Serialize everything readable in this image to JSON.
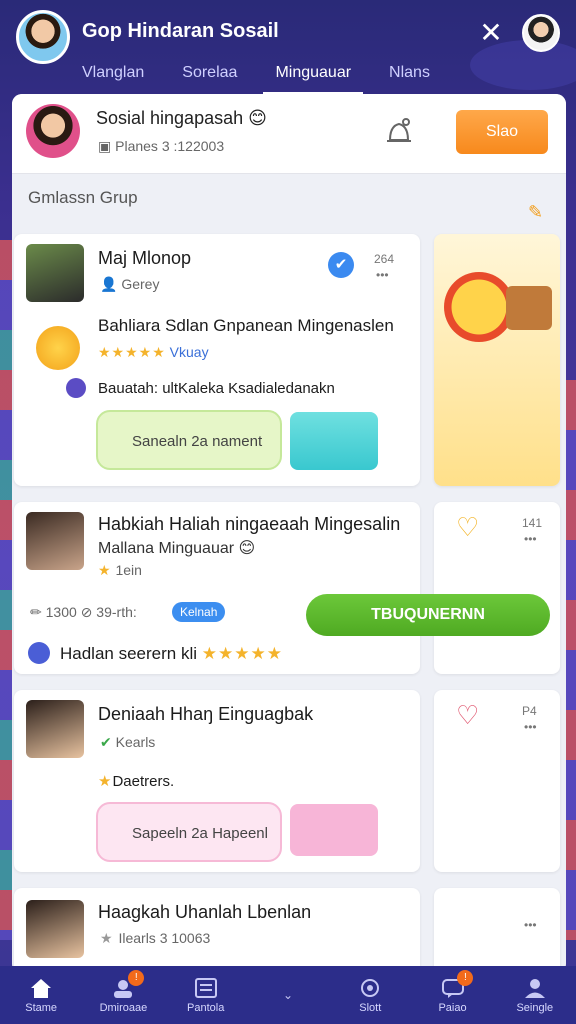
{
  "header": {
    "title": "Gop Hindaran Sosail",
    "close_symbol": "✕",
    "tabs": [
      "Vlanglan",
      "Sorelaa",
      "Minguauar",
      "Nlans"
    ],
    "active_tab": 2
  },
  "group": {
    "title": "Sosial hingapasah 😊",
    "sub": "Planes 3 :122003",
    "join_label": "Slao"
  },
  "section": {
    "label": "Gmlassn Grup"
  },
  "posts": [
    {
      "name": "Maj Mlonop",
      "sub": "Gerey",
      "count": "264",
      "text": "Bahliara Sdlan Gnpanean Mingenaslen",
      "stars": "★★★★★",
      "tag": "Vkuay",
      "line2": "Bauatah: ultKaleka Ksadialedanakn",
      "pill_label": "Sanealn 2a",
      "pill_sub": "nament"
    },
    {
      "name": "Habkiah Haliah ningaeaah Mingesalin",
      "sub": "Mallana Minguauar 😊",
      "sub2": "1ein",
      "count": "141",
      "metric_a": "1300",
      "metric_b": "39-rth:",
      "tag": "Kelnah",
      "line2": "Hadlan seerern kli",
      "stars": "★★★★★",
      "cta_label": "TBUQUNERNN"
    },
    {
      "name": "Deniaah Hhaŋ Einguagbak",
      "sub": "Kearls",
      "count": "P4",
      "line2": "Daetrers.",
      "pill_label": "Sapeeln 2a",
      "pill_sub": "Hapeenl"
    },
    {
      "name": "Haagkah Uhanlah Lbenlan",
      "sub": "Ilearls 3 10063"
    }
  ],
  "bottom_nav": [
    {
      "label": "Stame",
      "icon": "home-icon",
      "badge": ""
    },
    {
      "label": "Dmiroaae",
      "icon": "users-icon",
      "badge": "!"
    },
    {
      "label": "Pantola",
      "icon": "list-icon",
      "badge": ""
    },
    {
      "label": "",
      "icon": "chevron-down-icon",
      "badge": ""
    },
    {
      "label": "Slott",
      "icon": "game-icon",
      "badge": ""
    },
    {
      "label": "Paiao",
      "icon": "message-icon",
      "badge": "!"
    },
    {
      "label": "Seingle",
      "icon": "profile-icon",
      "badge": ""
    }
  ],
  "colors": {
    "accent_orange": "#f7891c",
    "accent_green": "#4faa22",
    "nav_bg": "#2c2d8a"
  }
}
